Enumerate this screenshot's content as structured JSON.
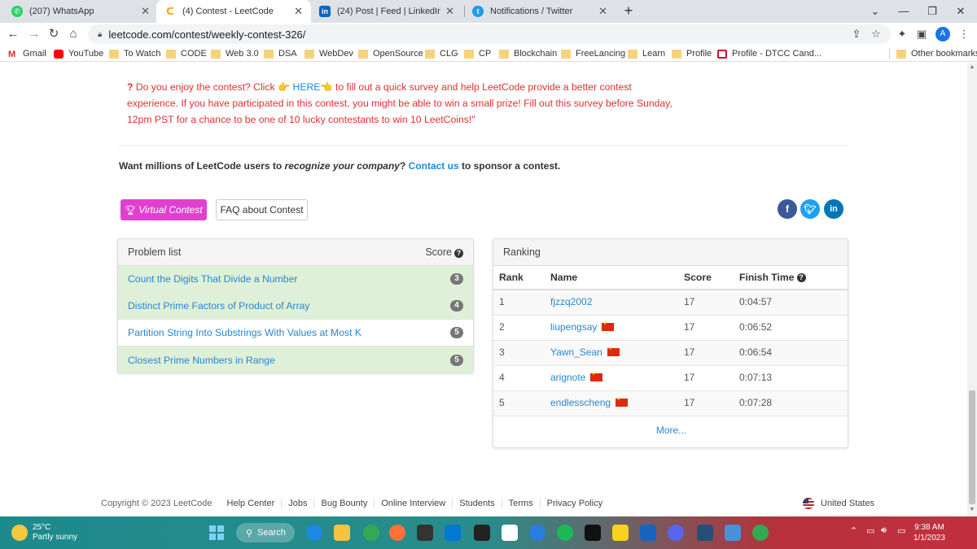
{
  "browser": {
    "tabs": [
      {
        "title": "(207) WhatsApp",
        "icon": "whatsapp-icon",
        "color": "#25d366",
        "active": false
      },
      {
        "title": "(4) Contest - LeetCode",
        "icon": "leetcode-icon",
        "color": "#ffa116",
        "active": true
      },
      {
        "title": "(24) Post | Feed | LinkedIn",
        "icon": "linkedin-icon",
        "color": "#0a66c2",
        "active": false
      },
      {
        "title": "Notifications / Twitter",
        "icon": "twitter-icon",
        "color": "#1d9bf0",
        "active": false
      }
    ],
    "url": "leetcode.com/contest/weekly-contest-326/",
    "profile_initial": "A",
    "bookmarks": [
      {
        "label": "Gmail",
        "icon": "gmail-icon"
      },
      {
        "label": "YouTube",
        "icon": "youtube-icon"
      },
      {
        "label": "To Watch",
        "icon": "folder-icon"
      },
      {
        "label": "CODE",
        "icon": "folder-icon"
      },
      {
        "label": "Web 3.0",
        "icon": "folder-icon"
      },
      {
        "label": "DSA",
        "icon": "folder-icon"
      },
      {
        "label": "WebDev",
        "icon": "folder-icon"
      },
      {
        "label": "OpenSource",
        "icon": "folder-icon"
      },
      {
        "label": "CLG",
        "icon": "folder-icon"
      },
      {
        "label": "CP",
        "icon": "folder-icon"
      },
      {
        "label": "Blockchain",
        "icon": "folder-icon"
      },
      {
        "label": "FreeLancing",
        "icon": "folder-icon"
      },
      {
        "label": "Learn",
        "icon": "folder-icon"
      },
      {
        "label": "Profile",
        "icon": "folder-icon"
      },
      {
        "label": "Profile - DTCC Cand...",
        "icon": "dtcc-icon"
      }
    ],
    "other_bookmarks": "Other bookmarks"
  },
  "survey": {
    "qmark": "?",
    "before": " Do you enjoy the contest? Click ",
    "link": "HERE",
    "after": " to fill out a quick survey and help LeetCode provide a better contest experience. If you have participated in this contest, you might be able to win a small prize! Fill out this survey before Sunday, 12pm PST for a chance to be one of 10 lucky contestants to win 10 LeetCoins!\""
  },
  "sponsor": {
    "part1": "Want millions of LeetCode users to ",
    "emphasis": "recognize your company",
    "part2": "? ",
    "link": "Contact us",
    "part3": " to sponsor a contest."
  },
  "buttons": {
    "virtual": "Virtual Contest",
    "faq": "FAQ about Contest"
  },
  "social": [
    {
      "icon": "facebook-icon",
      "glyph": "f",
      "color": "#3b5998"
    },
    {
      "icon": "twitter-icon",
      "glyph": "t",
      "color": "#1da1f2"
    },
    {
      "icon": "linkedin-icon",
      "glyph": "in",
      "color": "#0077b5"
    }
  ],
  "problems": {
    "header": "Problem list",
    "score_header": "Score",
    "items": [
      {
        "name": "Count the Digits That Divide a Number",
        "score": "3",
        "solved": true
      },
      {
        "name": "Distinct Prime Factors of Product of Array",
        "score": "4",
        "solved": true
      },
      {
        "name": "Partition String Into Substrings With Values at Most K",
        "score": "5",
        "solved": false
      },
      {
        "name": "Closest Prime Numbers in Range",
        "score": "5",
        "solved": true
      }
    ]
  },
  "ranking": {
    "header": "Ranking",
    "columns": {
      "rank": "Rank",
      "name": "Name",
      "score": "Score",
      "time": "Finish Time"
    },
    "rows": [
      {
        "rank": "1",
        "name": "fjzzq2002",
        "flag": false,
        "score": "17",
        "time": "0:04:57"
      },
      {
        "rank": "2",
        "name": "liupengsay",
        "flag": true,
        "score": "17",
        "time": "0:06:52"
      },
      {
        "rank": "3",
        "name": "Yawn_Sean",
        "flag": true,
        "score": "17",
        "time": "0:06:54"
      },
      {
        "rank": "4",
        "name": "arignote",
        "flag": true,
        "score": "17",
        "time": "0:07:13"
      },
      {
        "rank": "5",
        "name": "endlesscheng",
        "flag": true,
        "score": "17",
        "time": "0:07:28"
      }
    ],
    "more": "More..."
  },
  "footer": {
    "copyright": "Copyright © 2023 LeetCode",
    "links": [
      "Help Center",
      "Jobs",
      "Bug Bounty",
      "Online Interview",
      "Students",
      "Terms",
      "Privacy Policy"
    ],
    "country": "United States"
  },
  "taskbar": {
    "temperature": "25°C",
    "weather": "Partly sunny",
    "search": "Search",
    "time": "9:38 AM",
    "date": "1/1/2023"
  }
}
